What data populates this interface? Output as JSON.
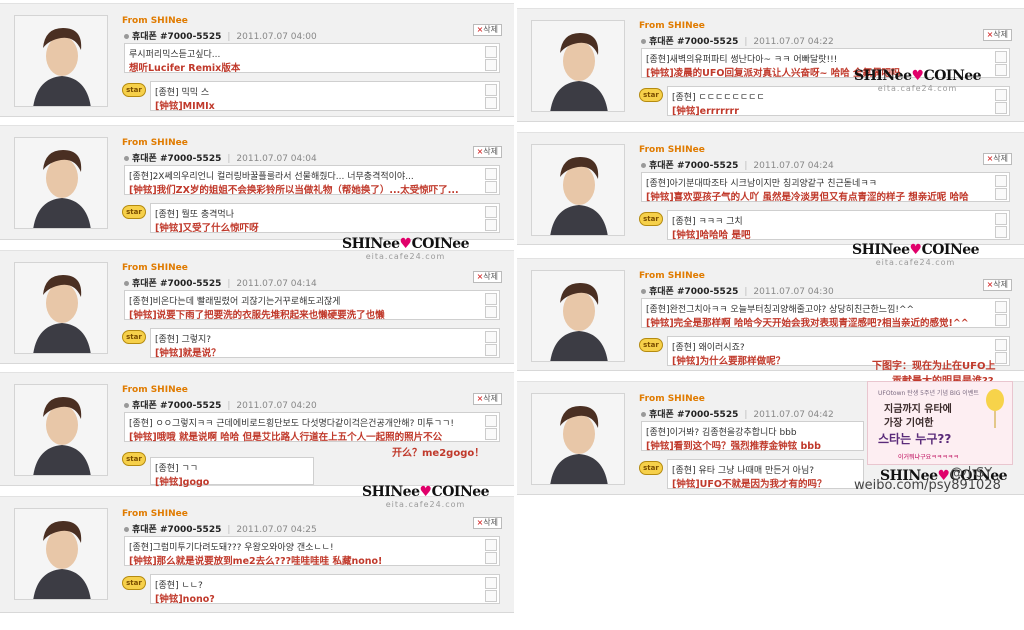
{
  "cards": [
    {
      "from": "From SHINee",
      "phone": "휴대폰 #7000-5525",
      "date": "2011.07.07 04:00",
      "delete": "삭제",
      "msg_kr": "루시퍼리믹스듣고싶다...",
      "msg_cn": "想听Lucifer Remix版本",
      "reply_kr": "[종현] 믹믹 스",
      "reply_cn": "[钟铉]MIMIx",
      "star": "star"
    },
    {
      "from": "From SHINee",
      "phone": "휴대폰 #7000-5525",
      "date": "2011.07.07 04:04",
      "delete": "삭제",
      "msg_kr": "[종현]2X쎄의우리언니 컬러링바꿀플룰라서 선물해줬다... 너무충격적이야...",
      "msg_cn": "[钟铉]我们ZX岁的姐姐不会换彩铃所以当做礼物（帮她换了）...太受惊吓了...",
      "reply_kr": "[종현] 뭘또 충격먹나",
      "reply_cn": "[钟铉]又受了什么惊吓呀",
      "star": "star"
    },
    {
      "from": "From SHINee",
      "phone": "휴대폰 #7000-5525",
      "date": "2011.07.07 04:14",
      "delete": "삭제",
      "msg_kr": "[종현]비온다는데 빨래밀렸어 괴잖기는거꾸로해도괴잖게",
      "msg_cn": "[钟铉]说要下雨了把要洗的衣服先堆积起来也懒硬要洗了也懒",
      "reply_kr": "[종현] 그렇지?",
      "reply_cn": "[钟铉]就是说？",
      "star": "star"
    },
    {
      "from": "From SHINee",
      "phone": "휴대폰 #7000-5525",
      "date": "2011.07.07 04:20",
      "delete": "삭제",
      "msg_kr": "[종현] ㅇㅇ그렇지ㅋㅋ 근데에비로드횡단보도 다섯명다같이걱은건공개안해? 미투ㄱㄱ!",
      "msg_cn": "[钟铉]哦哦 就是说啊 哈哈 但是艾比路人行道在上五个人一起照的照片不公",
      "msg_overflow": "开么？me2gogo！",
      "reply_kr": "[종현] ㄱㄱ",
      "reply_cn": "[钟铉]gogo",
      "star": "star"
    },
    {
      "from": "From SHINee",
      "phone": "휴대폰 #7000-5525",
      "date": "2011.07.07 04:25",
      "delete": "삭제",
      "msg_kr": "[종현]그럼미투기다려도돼??? 우왕오와아양 갠소ㄴㄴ!",
      "msg_cn": "[钟铉]那么就是说要放到me2去么???哇哇哇哇 私藏nono!",
      "reply_kr": "[종현] ㄴㄴ?",
      "reply_cn": "[钟铉]nono?",
      "star": "star"
    },
    {
      "from": "From SHINee",
      "phone": "휴대폰 #7000-5525",
      "date": "2011.07.07 04:22",
      "delete": "삭제",
      "msg_kr": "[종현]새벽의유퍼파티 썽난다아~ ㅋㅋ 어빠달랏!!!",
      "msg_cn": "[钟铉]凌晨的UFO回复派对真让人兴奋呀~ 哈哈 全氟偶吧吗",
      "reply_kr": "[종현] ㄷㄷㄷㄷㄷㄷㄷㄷ",
      "reply_cn": "[钟铉]errrrrrr",
      "star": "star"
    },
    {
      "from": "From SHINee",
      "phone": "휴대폰 #7000-5525",
      "date": "2011.07.07 04:24",
      "delete": "삭제",
      "msg_kr": "[종현]아기분대따조타 시크남이지만 칭괴양같구 친근돋네ㅋㅋ",
      "msg_cn": "[钟铉]喜欢耍孩子气的人吖  虽然是冷淡男但又有点青涩的样子 想亲近呢 哈哈",
      "reply_kr": "[종현] ㅋㅋㅋ 그치",
      "reply_cn": "[钟铉]哈哈哈 是吧",
      "star": "star"
    },
    {
      "from": "From SHINee",
      "phone": "휴대폰 #7000-5525",
      "date": "2011.07.07 04:30",
      "delete": "삭제",
      "msg_kr": "[종현]완전그치아ㅋㅋ 오늘부터칭괴양해줄고야? 상당히친근한느낌!^^",
      "msg_cn": "[钟铉]完全是那样啊 哈哈今天开始会我对表现青涩感吧?相当亲近的感觉!^^",
      "reply_kr": "[종현] 왜이러시죠?",
      "reply_cn": "[钟铉]为什么要那样做呢？",
      "star": "star"
    },
    {
      "from": "From SHINee",
      "phone": "휴대폰 #7000-5525",
      "date": "2011.07.07 04:42",
      "delete": "삭제",
      "msg_kr": "[종현]이거봐? 김종현을강추합니다 bbb",
      "msg_cn": "[钟铉]看到这个吗？强烈推荐金钟铉 bbb",
      "reply_kr": "[종현] 유타 그냥 나때매 만든거 아님?",
      "reply_cn": "[钟铉]UFO不就是因为我才有的吗？",
      "star": "star"
    }
  ],
  "watermark": {
    "logo_a": "SHINee",
    "logo_b": "COINee",
    "site": "eita.cafe24.com"
  },
  "caption": {
    "line1": "下图字：现在为止在UFO上",
    "line2": "贡献最大的明星是谁??"
  },
  "promo": {
    "small": "UFOtown 탄생 5주년 기념 BIG 이벤트",
    "line1": "지금까지 유타에",
    "line2": "가장 기여한",
    "line3": "스타는 누구??",
    "tag": "이거뭐냐구요ㅋㅋㅋㅋㅋ"
  },
  "credit": {
    "user": "@小SY",
    "weibo": "weibo.com/psy891028"
  },
  "colors": {
    "accent_orange": "#e07b00",
    "translation_red": "#c0392b",
    "heart_pink": "#e0006a"
  }
}
